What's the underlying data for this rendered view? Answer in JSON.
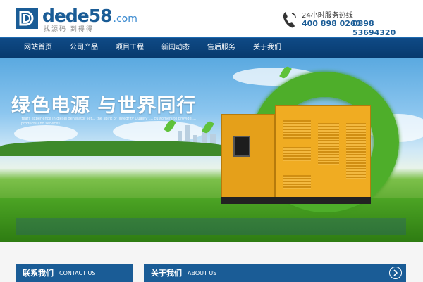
{
  "brand": {
    "logo_text": "dede58",
    "logo_suffix": ".com",
    "tagline": "找源码 到得得"
  },
  "hotline": {
    "label": "24小时服务热线",
    "phone_1": "400 898 0260",
    "phone_2": "0898 53694320"
  },
  "nav": {
    "items": [
      {
        "label": "网站首页"
      },
      {
        "label": "公司产品"
      },
      {
        "label": "项目工程"
      },
      {
        "label": "新闻动态"
      },
      {
        "label": "售后服务"
      },
      {
        "label": "关于我们"
      }
    ]
  },
  "banner": {
    "headline": "绿色电源 与世界同行",
    "subtext": "Years experience in diesel generator set... the spirit of 'Integrity Quality' ... customers to provide ... products and services"
  },
  "sections": {
    "contact": {
      "title": "联系我们",
      "subtitle": "CONTACT US"
    },
    "about": {
      "title": "关于我们",
      "subtitle": "ABOUT US"
    }
  },
  "colors": {
    "brand_blue": "#1a5c96",
    "nav_blue": "#0a3f76",
    "grass_green": "#4ca424",
    "generator_yellow": "#f0ac22"
  },
  "icons": {
    "phone": "phone-icon",
    "more": "chevron-right-circle-icon"
  }
}
